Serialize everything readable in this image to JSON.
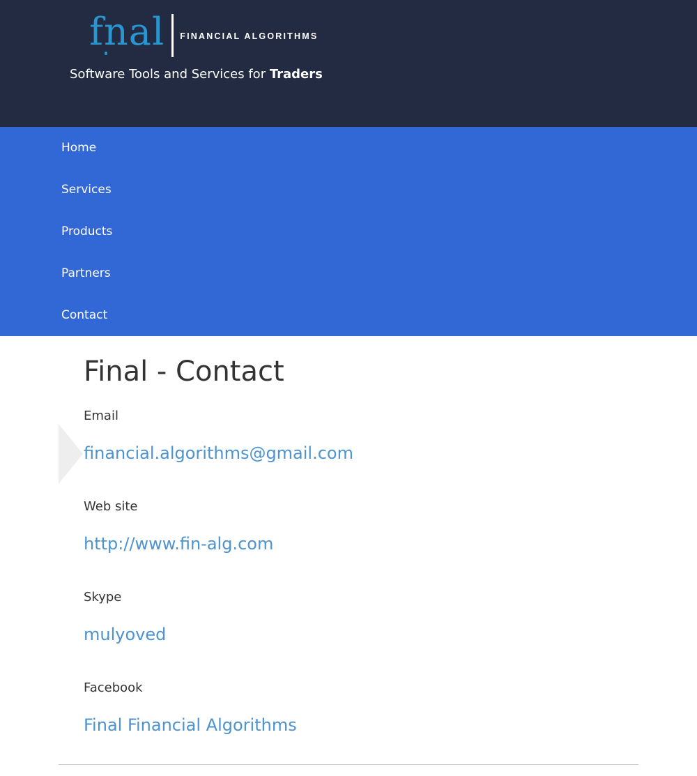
{
  "header": {
    "logo": {
      "word": "fnal",
      "tagline": "FINANCIAL ALGORITHMS"
    },
    "slogan_prefix": "Software Tools and Services for ",
    "slogan_bold": "Traders"
  },
  "nav": {
    "items": [
      "Home",
      "Services",
      "Products",
      "Partners",
      "Contact"
    ]
  },
  "main": {
    "title": "Final - Contact",
    "fields": [
      {
        "label": "Email",
        "value": "financial.algorithms@gmail.com"
      },
      {
        "label": "Web site",
        "value": "http://www.fin-alg.com"
      },
      {
        "label": "Skype",
        "value": "mulyoved"
      },
      {
        "label": "Facebook",
        "value": "Final Financial Algorithms"
      }
    ]
  },
  "colors": {
    "header_bg": "#222b42",
    "nav_bg": "#3268d6",
    "logo_blue": "#2b95cf",
    "link": "#4c93cf",
    "text": "#333333"
  }
}
